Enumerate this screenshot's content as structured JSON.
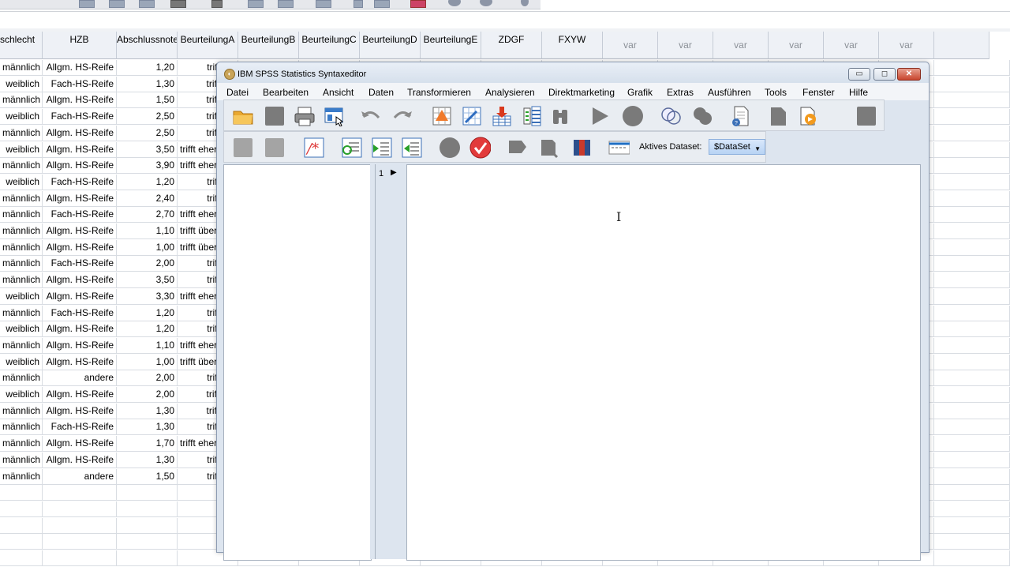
{
  "grid": {
    "columns": [
      "schlecht",
      "HZB",
      "Abschlussnote",
      "BeurteilungA",
      "BeurteilungB",
      "BeurteilungC",
      "BeurteilungD",
      "BeurteilungE",
      "ZDGF",
      "FXYW",
      "var",
      "var",
      "var",
      "var",
      "var",
      "var"
    ],
    "rows": [
      [
        "männlich",
        "Allgm. HS-Reife",
        "1,20",
        "trifft vo"
      ],
      [
        "weiblich",
        "Fach-HS-Reife",
        "1,30",
        "trifft eh"
      ],
      [
        "männlich",
        "Allgm. HS-Reife",
        "1,50",
        "trifft eh"
      ],
      [
        "weiblich",
        "Fach-HS-Reife",
        "2,50",
        "trifft eh"
      ],
      [
        "männlich",
        "Allgm. HS-Reife",
        "2,50",
        "trifft eh"
      ],
      [
        "weiblich",
        "Allgm. HS-Reife",
        "3,50",
        "trifft eher"
      ],
      [
        "männlich",
        "Allgm. HS-Reife",
        "3,90",
        "trifft eher"
      ],
      [
        "weiblich",
        "Fach-HS-Reife",
        "1,20",
        "trifft vo"
      ],
      [
        "männlich",
        "Allgm. HS-Reife",
        "2,40",
        "trifft vo"
      ],
      [
        "männlich",
        "Fach-HS-Reife",
        "2,70",
        "trifft eher"
      ],
      [
        "männlich",
        "Allgm. HS-Reife",
        "1,10",
        "trifft über"
      ],
      [
        "männlich",
        "Allgm. HS-Reife",
        "1,00",
        "trifft über"
      ],
      [
        "männlich",
        "Fach-HS-Reife",
        "2,00",
        "trifft vo"
      ],
      [
        "männlich",
        "Allgm. HS-Reife",
        "3,50",
        "trifft vo"
      ],
      [
        "weiblich",
        "Allgm. HS-Reife",
        "3,30",
        "trifft eher"
      ],
      [
        "männlich",
        "Fach-HS-Reife",
        "1,20",
        "trifft vo"
      ],
      [
        "weiblich",
        "Allgm. HS-Reife",
        "1,20",
        "trifft vo"
      ],
      [
        "männlich",
        "Allgm. HS-Reife",
        "1,10",
        "trifft eher"
      ],
      [
        "weiblich",
        "Allgm. HS-Reife",
        "1,00",
        "trifft über"
      ],
      [
        "männlich",
        "andere",
        "2,00",
        "trifft vo"
      ],
      [
        "weiblich",
        "Allgm. HS-Reife",
        "2,00",
        "trifft eh"
      ],
      [
        "männlich",
        "Allgm. HS-Reife",
        "1,30",
        "trifft eh"
      ],
      [
        "männlich",
        "Fach-HS-Reife",
        "1,30",
        "trifft vo"
      ],
      [
        "männlich",
        "Allgm. HS-Reife",
        "1,70",
        "trifft eher"
      ],
      [
        "männlich",
        "Allgm. HS-Reife",
        "1,30",
        "trifft vo"
      ],
      [
        "männlich",
        "andere",
        "1,50",
        "trifft vo"
      ]
    ]
  },
  "syntax_window": {
    "title": "IBM SPSS Statistics Syntaxeditor",
    "menu": [
      "Datei",
      "Bearbeiten",
      "Ansicht",
      "Daten",
      "Transformieren",
      "Analysieren",
      "Direktmarketing",
      "Grafik",
      "Extras",
      "Ausführen",
      "Tools",
      "Fenster",
      "Hilfe"
    ],
    "active_dataset_label": "Aktives Dataset:",
    "active_dataset_value": "$DataSet",
    "line_number": "1",
    "toolbar1_icons": [
      "open-folder-icon",
      "save-icon",
      "print-icon",
      "dialog-recall-icon",
      "undo-icon",
      "redo-icon",
      "goto-case-icon",
      "goto-variable-icon",
      "import-icon",
      "variables-icon",
      "find-icon",
      "run-icon",
      "stop-icon",
      "venn-icon",
      "toggle-icon",
      "new-file-icon",
      "bookmark-icon",
      "export-icon",
      "square-icon"
    ],
    "toolbar2_icons": [
      "comment-left-icon",
      "comment-right-icon",
      "comment-icon",
      "indent-icon",
      "indent-right-icon",
      "indent-left-icon",
      "breakpoint-icon",
      "validate-icon",
      "tag-icon",
      "tag-b-icon",
      "book-icon",
      "wrap-icon"
    ],
    "colors": {
      "accent": "#1f6fc4",
      "validate": "#d7262c",
      "toolbar_gray": "#7b7b7b"
    }
  }
}
